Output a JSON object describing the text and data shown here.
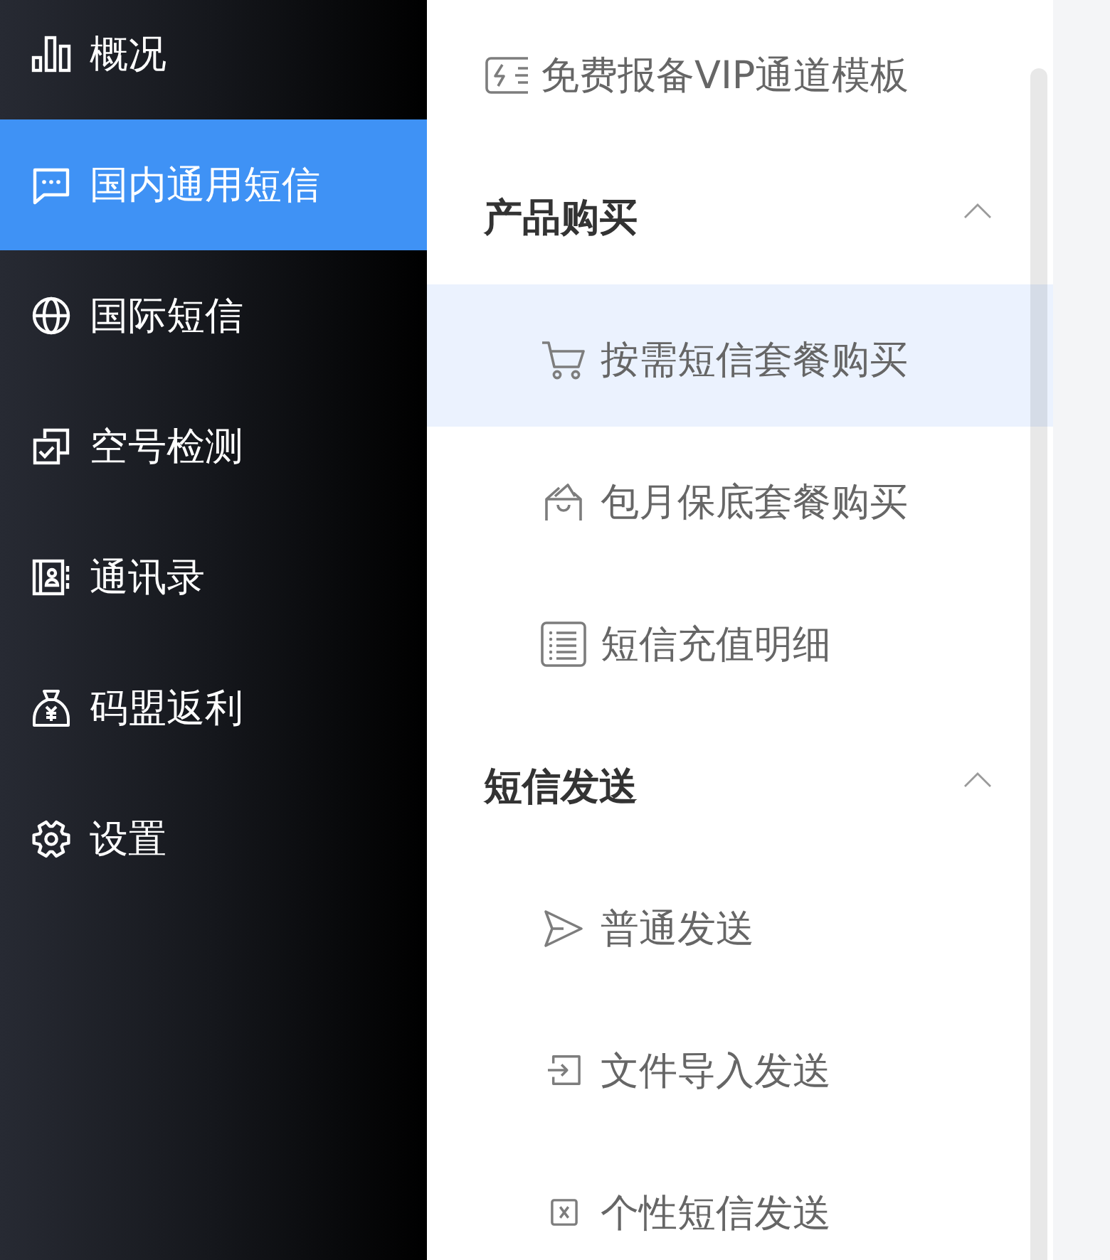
{
  "sidebar": {
    "items": [
      {
        "label": "概况",
        "selected": false
      },
      {
        "label": "国内通用短信",
        "selected": true
      },
      {
        "label": "国际短信",
        "selected": false
      },
      {
        "label": "空号检测",
        "selected": false
      },
      {
        "label": "通讯录",
        "selected": false
      },
      {
        "label": "码盟返利",
        "selected": false
      },
      {
        "label": "设置",
        "selected": false
      }
    ]
  },
  "submenu": {
    "items": [
      {
        "kind": "link",
        "label": "免费报备VIP通道模板",
        "selected": false
      },
      {
        "kind": "group",
        "label": "产品购买",
        "expanded": true,
        "children": [
          {
            "label": "按需短信套餐购买",
            "selected": true
          },
          {
            "label": "包月保底套餐购买",
            "selected": false
          },
          {
            "label": "短信充值明细",
            "selected": false
          }
        ]
      },
      {
        "kind": "group",
        "label": "短信发送",
        "expanded": true,
        "children": [
          {
            "label": "普通发送",
            "selected": false
          },
          {
            "label": "文件导入发送",
            "selected": false
          },
          {
            "label": "个性短信发送",
            "selected": false
          }
        ]
      }
    ]
  }
}
